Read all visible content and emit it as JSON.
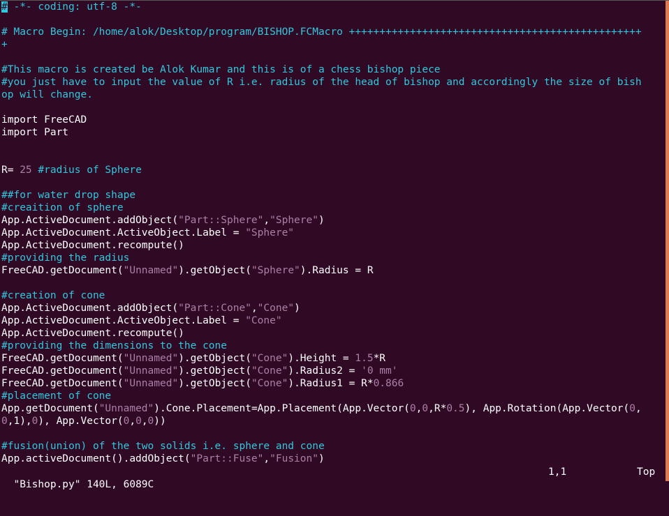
{
  "app": "vim terminal editor",
  "colors": {
    "background": "#300a24",
    "comment": "#33c7de",
    "string": "#ad7fa8",
    "text": "#ffffff",
    "scrollbar": "#e07b50"
  },
  "lines": [
    [
      {
        "t": "#",
        "cls": "cursor"
      },
      {
        "t": " -*- coding: utf-8 -*-",
        "cls": "c"
      }
    ],
    [],
    [
      {
        "t": "# Macro Begin: /home/alok/Desktop/program/BISHOP.FCMacro ++++++++++++++++++++++++++++++++++++++++++++++++",
        "cls": "c"
      }
    ],
    [
      {
        "t": "+",
        "cls": "c"
      }
    ],
    [],
    [
      {
        "t": "#This macro is created be Alok Kumar and this is of a chess bishop piece",
        "cls": "c"
      }
    ],
    [
      {
        "t": "#you just have to input the value of R i.e. radius of the head of bishop and accordingly the size of bish",
        "cls": "c"
      }
    ],
    [
      {
        "t": "op will change.",
        "cls": "c"
      }
    ],
    [],
    [
      {
        "t": "import FreeCAD",
        "cls": "k"
      }
    ],
    [
      {
        "t": "import Part",
        "cls": "k"
      }
    ],
    [],
    [],
    [
      {
        "t": "R= ",
        "cls": "k"
      },
      {
        "t": "25",
        "cls": "n"
      },
      {
        "t": " #radius of Sphere",
        "cls": "c"
      }
    ],
    [],
    [
      {
        "t": "##for water drop shape",
        "cls": "c"
      }
    ],
    [
      {
        "t": "#creaition of sphere",
        "cls": "c"
      }
    ],
    [
      {
        "t": "App.ActiveDocument.addObject(",
        "cls": "k"
      },
      {
        "t": "\"Part::Sphere\"",
        "cls": "s"
      },
      {
        "t": ",",
        "cls": "k"
      },
      {
        "t": "\"Sphere\"",
        "cls": "s"
      },
      {
        "t": ")",
        "cls": "k"
      }
    ],
    [
      {
        "t": "App.ActiveDocument.ActiveObject.Label = ",
        "cls": "k"
      },
      {
        "t": "\"Sphere\"",
        "cls": "s"
      }
    ],
    [
      {
        "t": "App.ActiveDocument.recompute()",
        "cls": "k"
      }
    ],
    [
      {
        "t": "#providing the radius",
        "cls": "c"
      }
    ],
    [
      {
        "t": "FreeCAD.getDocument(",
        "cls": "k"
      },
      {
        "t": "\"Unnamed\"",
        "cls": "s"
      },
      {
        "t": ").getObject(",
        "cls": "k"
      },
      {
        "t": "\"Sphere\"",
        "cls": "s"
      },
      {
        "t": ").Radius = R",
        "cls": "k"
      }
    ],
    [],
    [
      {
        "t": "#creation of cone",
        "cls": "c"
      }
    ],
    [
      {
        "t": "App.ActiveDocument.addObject(",
        "cls": "k"
      },
      {
        "t": "\"Part::Cone\"",
        "cls": "s"
      },
      {
        "t": ",",
        "cls": "k"
      },
      {
        "t": "\"Cone\"",
        "cls": "s"
      },
      {
        "t": ")",
        "cls": "k"
      }
    ],
    [
      {
        "t": "App.ActiveDocument.ActiveObject.Label = ",
        "cls": "k"
      },
      {
        "t": "\"Cone\"",
        "cls": "s"
      }
    ],
    [
      {
        "t": "App.ActiveDocument.recompute()",
        "cls": "k"
      }
    ],
    [
      {
        "t": "#providing the dimensions to the cone",
        "cls": "c"
      }
    ],
    [
      {
        "t": "FreeCAD.getDocument(",
        "cls": "k"
      },
      {
        "t": "\"Unnamed\"",
        "cls": "s"
      },
      {
        "t": ").getObject(",
        "cls": "k"
      },
      {
        "t": "\"Cone\"",
        "cls": "s"
      },
      {
        "t": ").Height = ",
        "cls": "k"
      },
      {
        "t": "1.5",
        "cls": "n"
      },
      {
        "t": "*R",
        "cls": "k"
      }
    ],
    [
      {
        "t": "FreeCAD.getDocument(",
        "cls": "k"
      },
      {
        "t": "\"Unnamed\"",
        "cls": "s"
      },
      {
        "t": ").getObject(",
        "cls": "k"
      },
      {
        "t": "\"Cone\"",
        "cls": "s"
      },
      {
        "t": ").Radius2 = ",
        "cls": "k"
      },
      {
        "t": "'0 mm'",
        "cls": "s"
      }
    ],
    [
      {
        "t": "FreeCAD.getDocument(",
        "cls": "k"
      },
      {
        "t": "\"Unnamed\"",
        "cls": "s"
      },
      {
        "t": ").getObject(",
        "cls": "k"
      },
      {
        "t": "\"Cone\"",
        "cls": "s"
      },
      {
        "t": ").Radius1 = R*",
        "cls": "k"
      },
      {
        "t": "0.866",
        "cls": "n"
      }
    ],
    [
      {
        "t": "#placement of cone",
        "cls": "c"
      }
    ],
    [
      {
        "t": "App.getDocument(",
        "cls": "k"
      },
      {
        "t": "\"Unnamed\"",
        "cls": "s"
      },
      {
        "t": ").Cone.Placement=App.Placement(App.Vector(",
        "cls": "k"
      },
      {
        "t": "0",
        "cls": "n"
      },
      {
        "t": ",",
        "cls": "k"
      },
      {
        "t": "0",
        "cls": "n"
      },
      {
        "t": ",R*",
        "cls": "k"
      },
      {
        "t": "0.5",
        "cls": "n"
      },
      {
        "t": "), App.Rotation(App.Vector(",
        "cls": "k"
      },
      {
        "t": "0",
        "cls": "n"
      },
      {
        "t": ",",
        "cls": "k"
      }
    ],
    [
      {
        "t": "0",
        "cls": "n"
      },
      {
        "t": ",1),",
        "cls": "k"
      },
      {
        "t": "0",
        "cls": "n"
      },
      {
        "t": "), App.Vector(",
        "cls": "k"
      },
      {
        "t": "0",
        "cls": "n"
      },
      {
        "t": ",",
        "cls": "k"
      },
      {
        "t": "0",
        "cls": "n"
      },
      {
        "t": ",",
        "cls": "k"
      },
      {
        "t": "0",
        "cls": "n"
      },
      {
        "t": "))",
        "cls": "k"
      }
    ],
    [],
    [
      {
        "t": "#fusion(union) of the two solids i.e. sphere and cone",
        "cls": "c"
      }
    ],
    [
      {
        "t": "App.activeDocument().addObject(",
        "cls": "k"
      },
      {
        "t": "\"Part::Fuse\"",
        "cls": "s"
      },
      {
        "t": ",",
        "cls": "k"
      },
      {
        "t": "\"Fusion\"",
        "cls": "s"
      },
      {
        "t": ")",
        "cls": "k"
      }
    ]
  ],
  "status": {
    "file_info": "\"Bishop.py\" 140L, 6089C",
    "cursor_position": "1,1",
    "scroll_position": "Top"
  }
}
